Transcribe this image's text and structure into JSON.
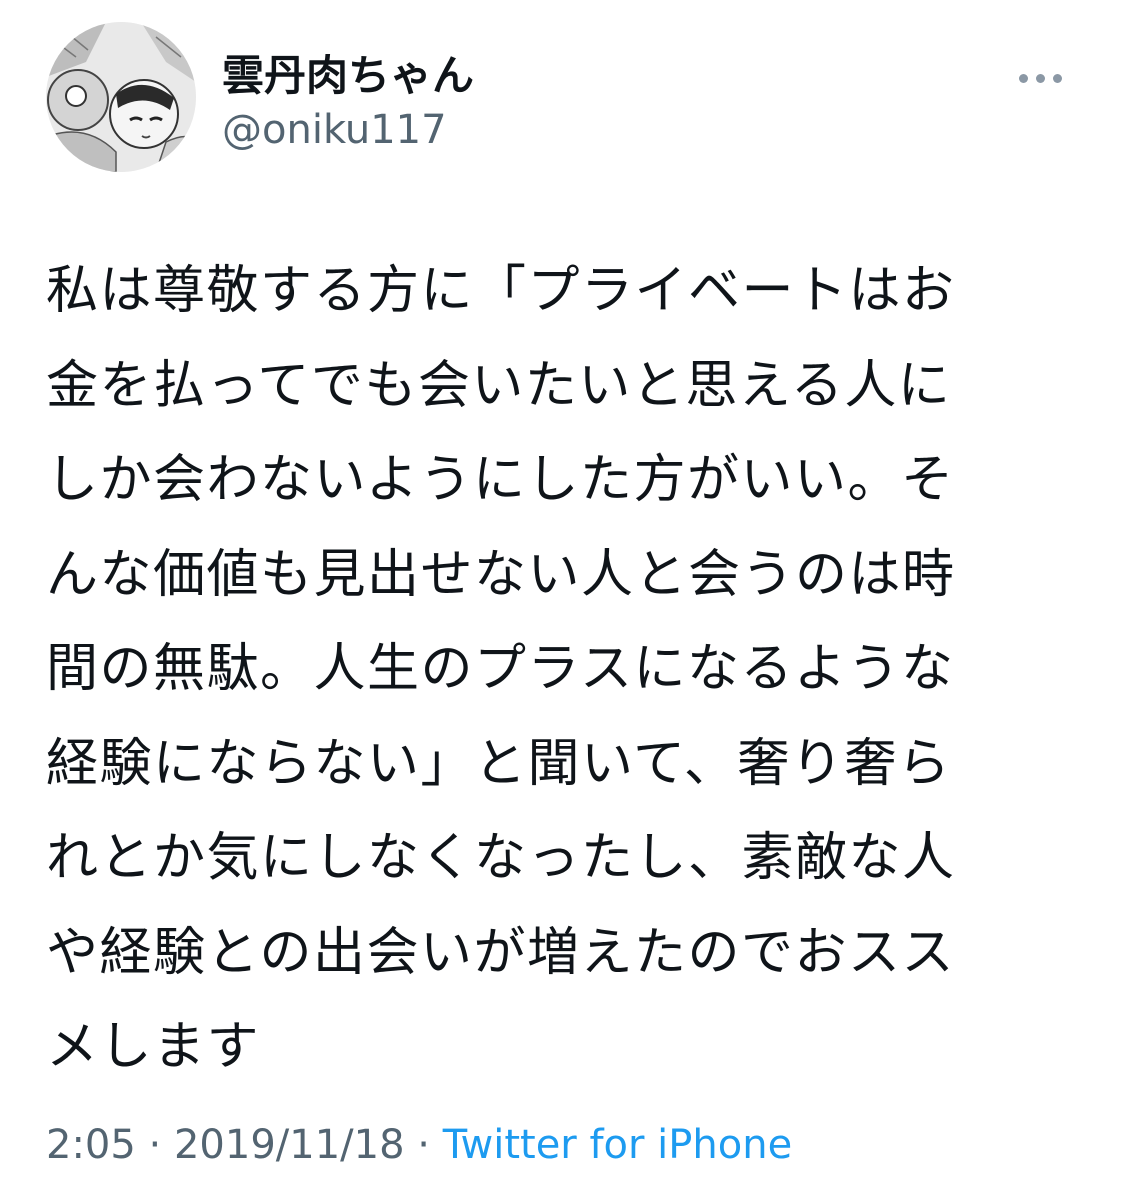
{
  "author": {
    "display_name": "雲丹肉ちゃん",
    "handle": "@oniku117"
  },
  "icons": {
    "more": "more-horizontal-icon",
    "avatar": "manga-portrait-avatar"
  },
  "tweet": {
    "lines": [
      "私は尊敬する方に「プライベートはお",
      "金を払ってでも会いたいと思える人に",
      "しか会わないようにした方がいい。そ",
      "んな価値も見出せない人と会うのは時",
      "間の無駄。人生のプラスになるような",
      "経験にならない」と聞いて、奢り奢ら",
      "れとか気にしなくなったし、素敵な人",
      "や経験との出会いが増えたのでおスス",
      "メします"
    ]
  },
  "meta": {
    "time": "2:05",
    "separator": " · ",
    "date": "2019/11/18",
    "source": "Twitter for iPhone"
  },
  "colors": {
    "text": "#0f1419",
    "secondary": "#536471",
    "link": "#1d9bf0",
    "background": "#ffffff"
  }
}
